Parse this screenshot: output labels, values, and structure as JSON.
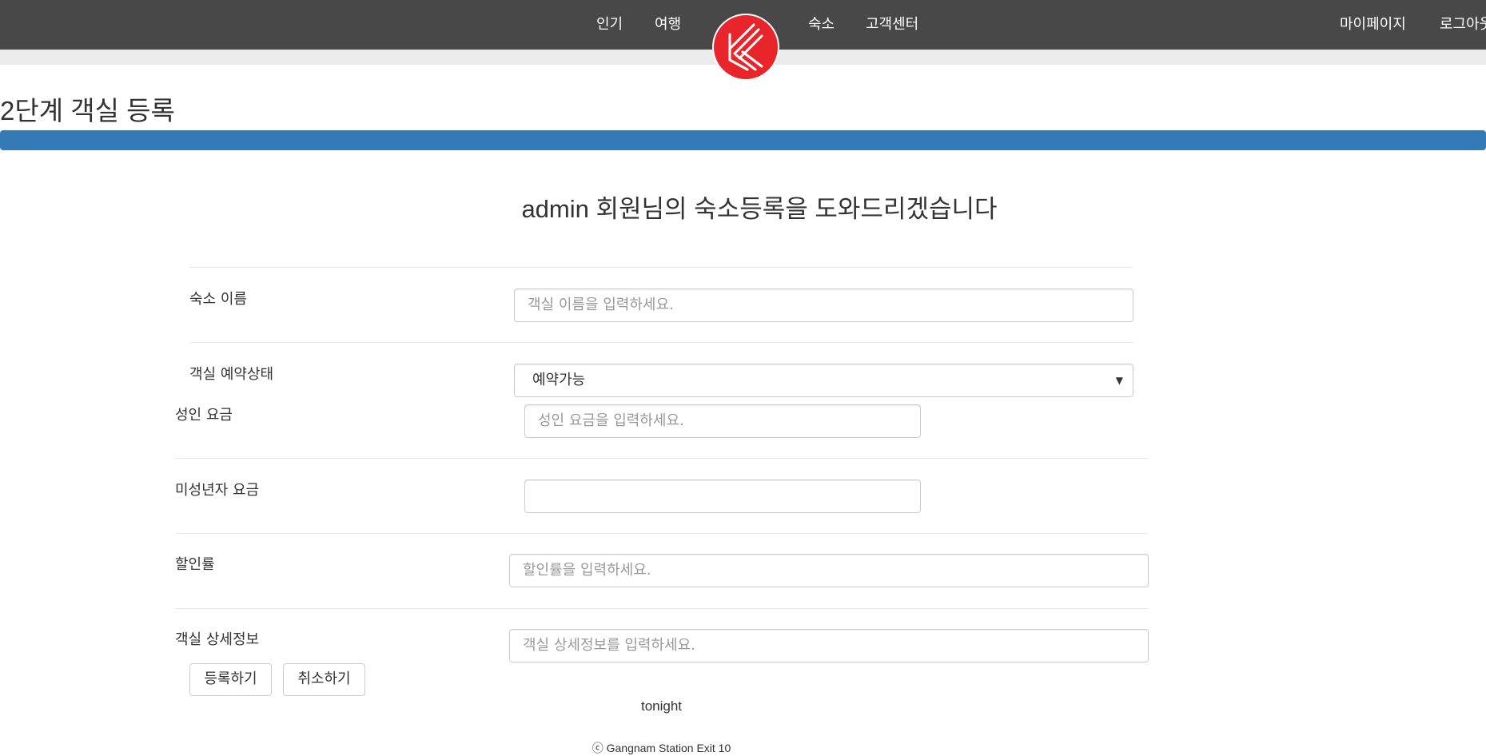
{
  "nav": {
    "items": [
      {
        "label": "인기"
      },
      {
        "label": "여행"
      },
      {
        "label": "숙소"
      },
      {
        "label": "고객센터"
      },
      {
        "label": "마이페이지"
      },
      {
        "label": "로그아웃"
      }
    ],
    "logo_color": "#e8252a",
    "bar_color": "#484848"
  },
  "page": {
    "step_title": "2단계 객실 등록",
    "welcome": "admin 회원님의 숙소등록을 도와드리겠습니다",
    "progress_percent": 100,
    "progress_color": "#337ab7"
  },
  "form": {
    "name_label": "숙소 이름",
    "name_placeholder": "객실 이름을 입력하세요.",
    "status_label": "객실 예약상태",
    "status_selected": "예약가능",
    "adult_label": "성인 요금",
    "adult_placeholder": "성인 요금을 입력하세요.",
    "minor_label": "미성년자 요금",
    "minor_value": "",
    "discount_label": "할인률",
    "discount_placeholder": "할인률을 입력하세요.",
    "detail_label": "객실 상세정보",
    "detail_placeholder": "객실 상세정보를 입력하세요.",
    "submit_label": "등록하기",
    "cancel_label": "취소하기"
  },
  "footer": {
    "brand": "tonight",
    "copyright": "ⓒ Gangnam Station Exit 10"
  }
}
